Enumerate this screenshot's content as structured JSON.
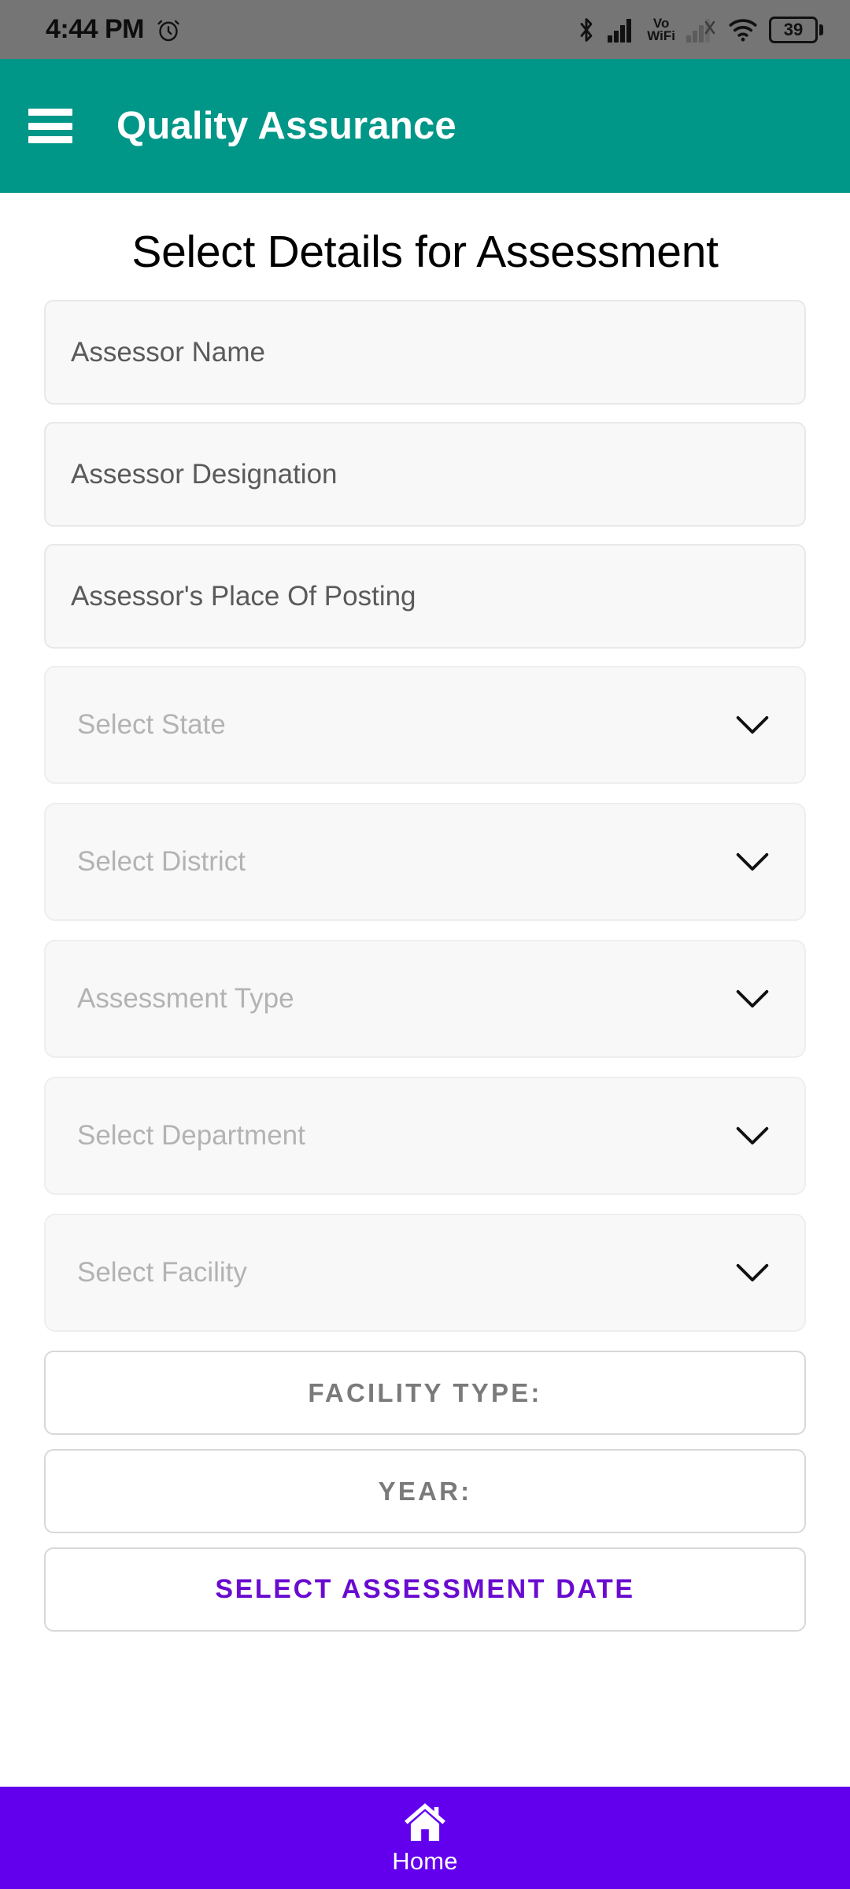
{
  "status_bar": {
    "time": "4:44 PM",
    "alarm_icon": "alarm-clock-icon",
    "bluetooth_icon": "bluetooth-icon",
    "signal_icon": "cellular-signal-icon",
    "vowifi_line1": "Vo",
    "vowifi_line2": "WiFi",
    "signal_alt_icon": "cellular-signal-no-service-icon",
    "wifi_icon": "wifi-icon",
    "battery_level": "39",
    "background_color": "#757575"
  },
  "app_bar": {
    "menu_icon": "hamburger-menu-icon",
    "title": "Quality Assurance",
    "background_color": "#009688",
    "text_color": "#ffffff"
  },
  "main": {
    "page_title": "Select Details for Assessment",
    "text_fields": [
      {
        "name": "assessor-name",
        "placeholder": "Assessor Name",
        "value": ""
      },
      {
        "name": "assessor-designation",
        "placeholder": "Assessor Designation",
        "value": ""
      },
      {
        "name": "assessor-place-of-posting",
        "placeholder": "Assessor's Place Of Posting",
        "value": ""
      }
    ],
    "dropdowns": [
      {
        "name": "select-state",
        "placeholder": "Select State",
        "value": "",
        "icon": "chevron-down-icon"
      },
      {
        "name": "select-district",
        "placeholder": "Select District",
        "value": "",
        "icon": "chevron-down-icon"
      },
      {
        "name": "assessment-type",
        "placeholder": "Assessment Type",
        "value": "",
        "icon": "chevron-down-icon"
      },
      {
        "name": "select-department",
        "placeholder": "Select Department",
        "value": "",
        "icon": "chevron-down-icon"
      },
      {
        "name": "select-facility",
        "placeholder": "Select Facility",
        "value": "",
        "icon": "chevron-down-icon"
      }
    ],
    "buttons": [
      {
        "name": "facility-type-button",
        "label": "FACILITY TYPE:",
        "color": "#7a7a7a"
      },
      {
        "name": "year-button",
        "label": "YEAR:",
        "color": "#7a7a7a"
      },
      {
        "name": "select-assessment-date-button",
        "label": "SELECT ASSESSMENT DATE",
        "color": "#6a0bd0"
      }
    ]
  },
  "bottom_nav": {
    "background_color": "#6200ee",
    "items": [
      {
        "name": "home",
        "label": "Home",
        "icon": "home-icon"
      }
    ]
  }
}
